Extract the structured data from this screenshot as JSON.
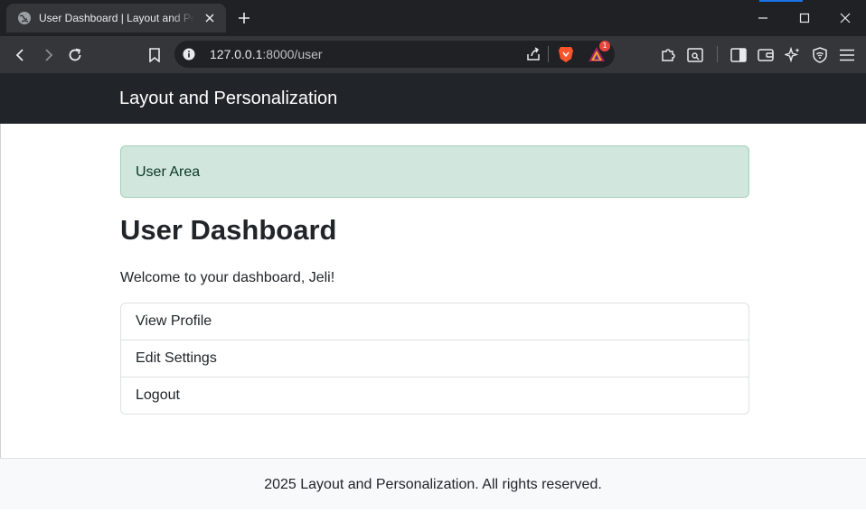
{
  "browser": {
    "tab": {
      "title": "User Dashboard | Layout and Personalization"
    },
    "address_bar": {
      "host": "127.0.0.1",
      "path": ":8000/user"
    },
    "brave_shields_count": "1"
  },
  "icons": {
    "favicon": "globe-icon",
    "tab_close": "close-icon",
    "new_tab": "plus-icon",
    "back": "arrow-left-icon",
    "forward": "arrow-right-icon",
    "reload": "reload-icon",
    "bookmark": "bookmark-icon",
    "site_info": "info-icon",
    "share": "share-icon",
    "shields": "brave-lion-icon",
    "rewards": "brave-rewards-icon",
    "extensions": "puzzle-icon",
    "screenshot": "screenshot-icon",
    "sidebar": "sidebar-icon",
    "wallet": "wallet-icon",
    "leo": "sparkle-icon",
    "vpn": "vpn-shield-icon",
    "menu": "hamburger-menu-icon"
  },
  "navbar": {
    "brand": "Layout and Personalization"
  },
  "alert": {
    "text": "User Area"
  },
  "main": {
    "title": "User Dashboard",
    "welcome": "Welcome to your dashboard, Jeli!",
    "links": [
      {
        "label": "View Profile"
      },
      {
        "label": "Edit Settings"
      },
      {
        "label": "Logout"
      }
    ]
  },
  "footer": {
    "text": "2025 Layout and Personalization. All rights reserved."
  },
  "colors": {
    "navbar_bg": "#212529",
    "alert_bg": "#d1e7dd",
    "alert_border": "#a3cfbb",
    "footer_bg": "#f8f9fa",
    "browser_chrome": "#35363a"
  }
}
